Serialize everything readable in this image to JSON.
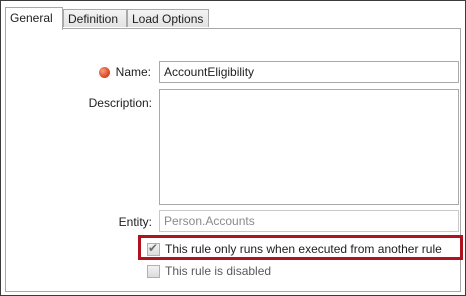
{
  "tabs": [
    {
      "label": "General",
      "active": true
    },
    {
      "label": "Definition",
      "active": false
    },
    {
      "label": "Load Options",
      "active": false
    }
  ],
  "form": {
    "name_label": "Name:",
    "name_value": "AccountEligibility",
    "description_label": "Description:",
    "description_value": "",
    "entity_label": "Entity:",
    "entity_value": "Person.Accounts"
  },
  "options": {
    "only_from_rule_label": "This rule only runs when executed from another rule",
    "only_from_rule_checked": true,
    "disabled_label": "This rule is disabled",
    "disabled_checked": false
  },
  "colors": {
    "required_indicator": "#e2512a",
    "highlight_border": "#b0121e"
  }
}
